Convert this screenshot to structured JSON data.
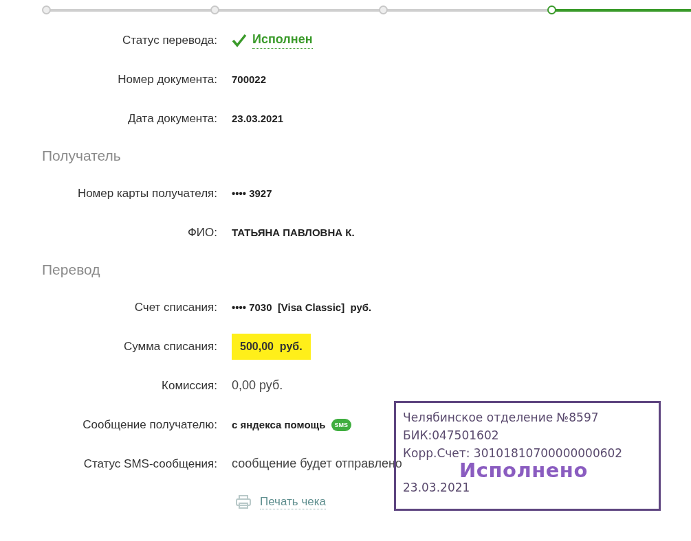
{
  "stepper": [
    {
      "selected": false
    },
    {
      "selected": false
    },
    {
      "selected": false
    },
    {
      "selected": true
    }
  ],
  "sections": [
    {
      "rows": [
        {
          "kind": "status",
          "label": "Статус перевода:",
          "value": "Исполнен"
        },
        {
          "kind": "bold",
          "label": "Номер документа:",
          "value": "700022"
        },
        {
          "kind": "bold",
          "label": "Дата документа:",
          "value": "23.03.2021"
        }
      ]
    },
    {
      "title": "Получатель",
      "rows": [
        {
          "kind": "bold",
          "label": "Номер карты получателя:",
          "value": "•••• 3927"
        },
        {
          "kind": "bold",
          "label": "ФИО:",
          "value": "ТАТЬЯНА ПАВЛОВНА К."
        }
      ]
    },
    {
      "title": "Перевод",
      "rows": [
        {
          "kind": "bold",
          "label": "Счет списания:",
          "value": "•••• 7030  [Visa Classic]  руб."
        },
        {
          "kind": "highlight",
          "label": "Сумма списания:",
          "value": "500,00  руб."
        },
        {
          "kind": "plain",
          "label": "Комиссия:",
          "value": "0,00 руб."
        },
        {
          "kind": "message",
          "label": "Сообщение получателю:",
          "value": "с яндекса помощь",
          "badge": "SMS"
        },
        {
          "kind": "plain",
          "label": "Статус SMS-сообщения:",
          "value": "сообщение будет отправлено"
        }
      ]
    }
  ],
  "print_link": "Печать чека",
  "stamp": {
    "lines": [
      "Челябинское отделение №8597",
      "БИК:047501602",
      "Корр.Счет: 30101810700000000602"
    ],
    "status": "Исполнено",
    "date": "23.03.2021"
  }
}
